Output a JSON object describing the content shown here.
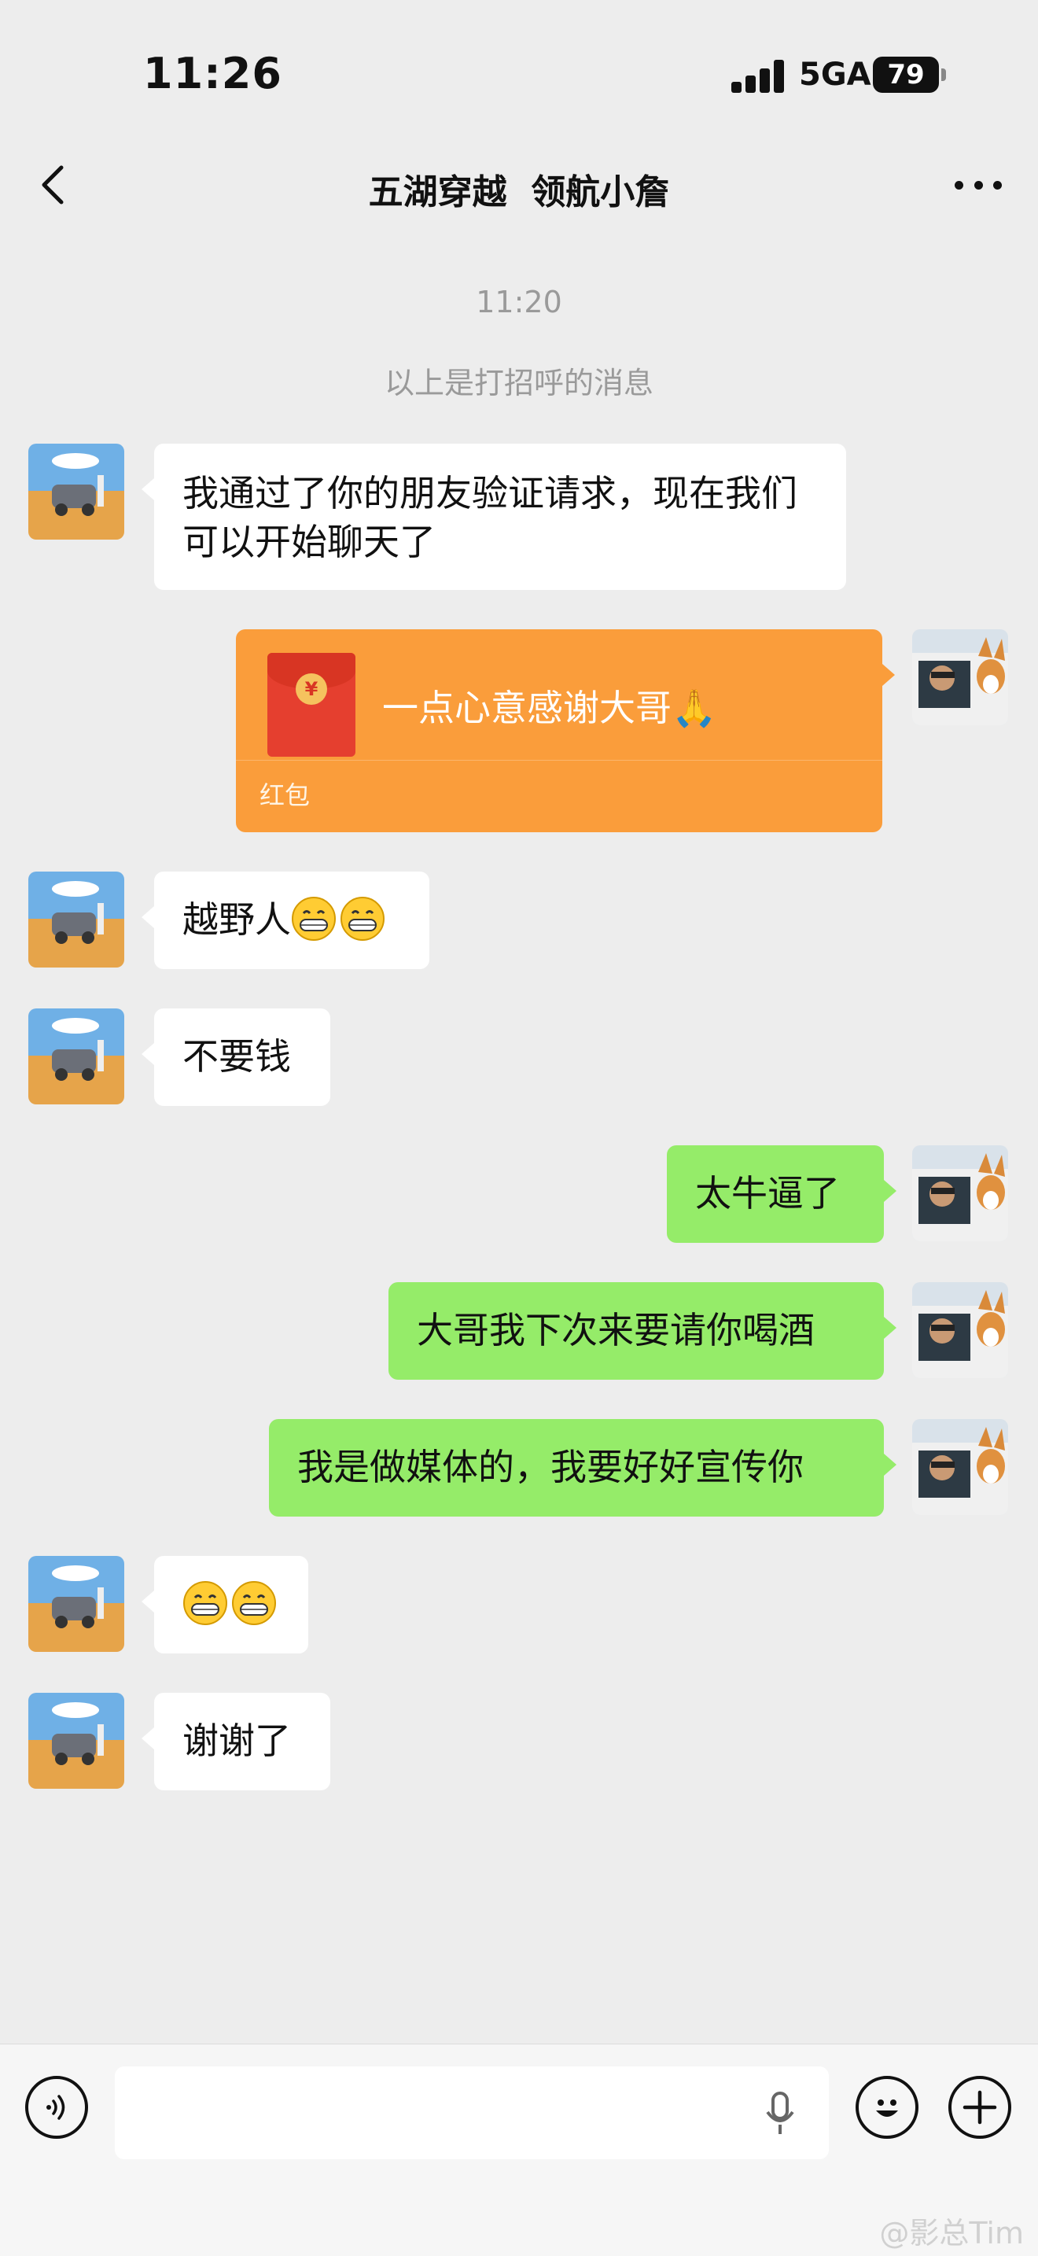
{
  "status_bar": {
    "time": "11:26",
    "network": "5GA",
    "battery": "79"
  },
  "nav": {
    "title": "五湖穿越  领航小詹",
    "back_icon": "chevron-left-icon",
    "more_icon": "more-dots-icon"
  },
  "system": {
    "time": "11:20",
    "note": "以上是打招呼的消息"
  },
  "messages": {
    "m1": "我通过了你的朋友验证请求，现在我们可以开始聊天了",
    "red_packet": {
      "text": "一点心意感谢大哥🙏",
      "label": "红包"
    },
    "m3": "越野人",
    "m4": "不要钱",
    "m5": "太牛逼了",
    "m6": "大哥我下次来要请你喝酒",
    "m7": "我是做媒体的，我要好好宣传你",
    "m9": "谢谢了"
  },
  "input_bar": {
    "voice_icon": "voice-icon",
    "emoji_icon": "emoji-icon",
    "add_icon": "plus-icon",
    "mic_icon": "mic-icon"
  },
  "watermark": "@影总Tim",
  "colors": {
    "background": "#ededed",
    "outgoing_bubble": "#95ec69",
    "incoming_bubble": "#ffffff",
    "red_packet": "#fa9d3b"
  }
}
